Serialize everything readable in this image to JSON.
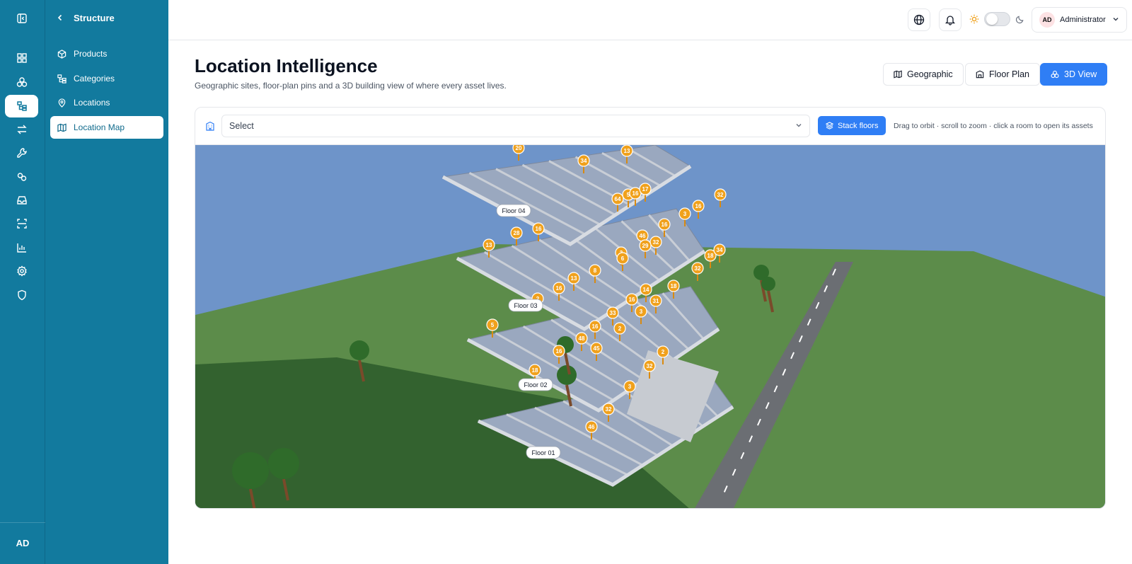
{
  "rail": {
    "items": [
      {
        "icon": "sidebar-toggle-icon"
      },
      {
        "icon": "dashboard-icon"
      },
      {
        "icon": "assets-icon"
      },
      {
        "icon": "structure-icon",
        "active": true
      },
      {
        "icon": "transfer-icon"
      },
      {
        "icon": "wrench-icon"
      },
      {
        "icon": "link-icon"
      },
      {
        "icon": "inbox-icon"
      },
      {
        "icon": "scan-icon"
      },
      {
        "icon": "chart-icon"
      },
      {
        "icon": "settings-icon"
      },
      {
        "icon": "shield-icon"
      }
    ],
    "avatar": "AD"
  },
  "sidebar": {
    "title": "Structure",
    "items": [
      {
        "label": "Products",
        "icon": "box-icon"
      },
      {
        "label": "Categories",
        "icon": "categories-icon"
      },
      {
        "label": "Locations",
        "icon": "pin-icon"
      },
      {
        "label": "Location Map",
        "icon": "map-icon",
        "active": true
      }
    ]
  },
  "topbar": {
    "user_initials": "AD",
    "user_name": "Administrator"
  },
  "header": {
    "title": "Location Intelligence",
    "subtitle": "Geographic sites, floor-plan pins and a 3D building view of where every asset lives."
  },
  "views": [
    {
      "label": "Geographic",
      "icon": "map-icon"
    },
    {
      "label": "Floor Plan",
      "icon": "floorplan-icon"
    },
    {
      "label": "3D View",
      "icon": "cube-icon",
      "active": true
    }
  ],
  "toolbar": {
    "select_placeholder": "Select",
    "stack_label": "Stack floors",
    "hint": "Drag to orbit · scroll to zoom · click a room to open its assets"
  },
  "scene": {
    "floors": [
      "Floor 04",
      "Floor 03",
      "Floor 02",
      "Floor 01"
    ],
    "pins": [
      "20",
      "34",
      "13",
      "64",
      "5",
      "16",
      "17",
      "32",
      "3",
      "16",
      "28",
      "16",
      "16",
      "46",
      "32",
      "29",
      "13",
      "3",
      "6",
      "18",
      "34",
      "32",
      "13",
      "8",
      "16",
      "14",
      "18",
      "31",
      "2",
      "16",
      "33",
      "3",
      "5",
      "16",
      "48",
      "2",
      "45",
      "16",
      "2",
      "18",
      "32",
      "3",
      "32",
      "46"
    ]
  },
  "colors": {
    "sidebar": "#127a9e",
    "accent": "#2f7ef5",
    "pin": "#f0a11c",
    "sky": "#6e94c9",
    "grass": "#5a8a4a"
  }
}
